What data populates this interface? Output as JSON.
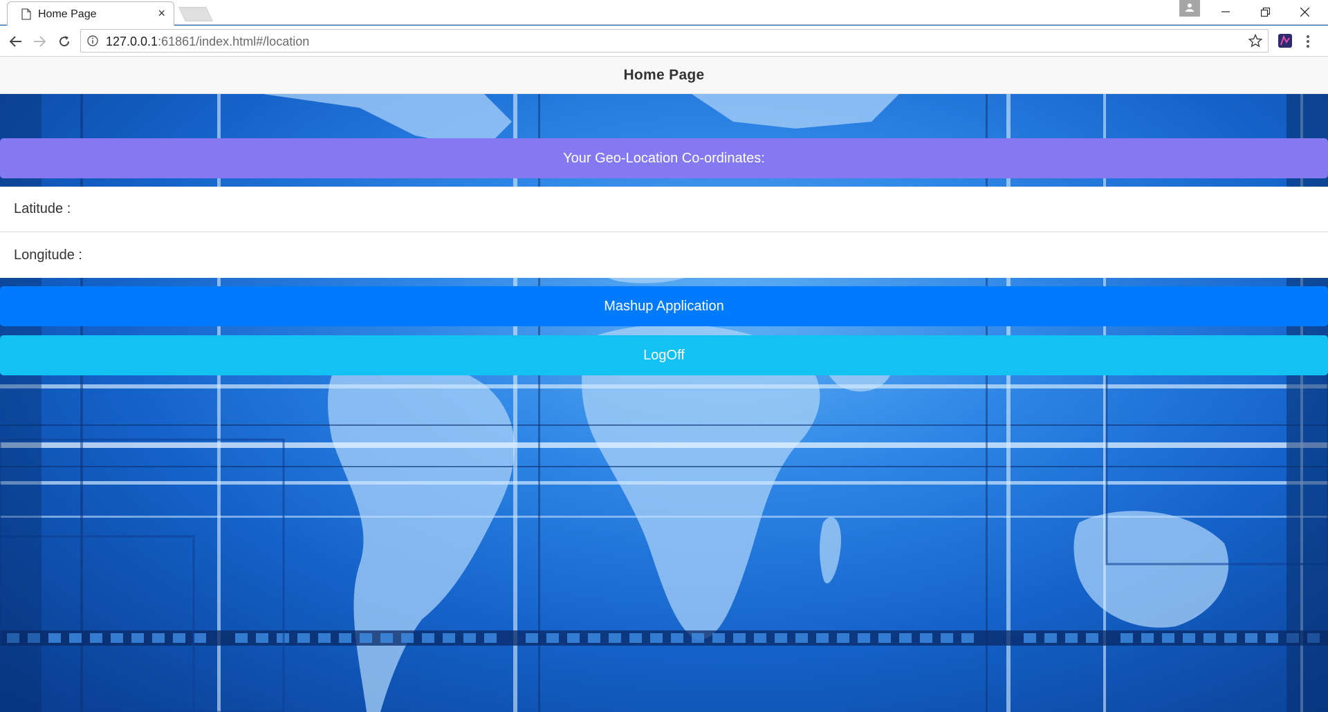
{
  "browser": {
    "tab_title": "Home Page",
    "tab_close": "×",
    "url_host": "127.0.0.1",
    "url_rest": ":61861/index.html#/location"
  },
  "page": {
    "navbar_title": "Home Page",
    "geo_header": "Your Geo-Location Co-ordinates:",
    "latitude_label": "Latitude :",
    "longitude_label": "Longitude :",
    "mashup_button": "Mashup Application",
    "logoff_button": "LogOff"
  },
  "colors": {
    "geo_header_bg": "#8579f2",
    "mashup_bg": "#007bff",
    "logoff_bg": "#13c1f2",
    "background_blue": "#1462c9"
  },
  "icons": [
    "page-icon",
    "close-icon",
    "profile-icon",
    "minimize-icon",
    "restore-icon",
    "window-close-icon",
    "back-icon",
    "forward-icon",
    "reload-icon",
    "info-icon",
    "star-icon",
    "extension-icon",
    "menu-icon"
  ]
}
